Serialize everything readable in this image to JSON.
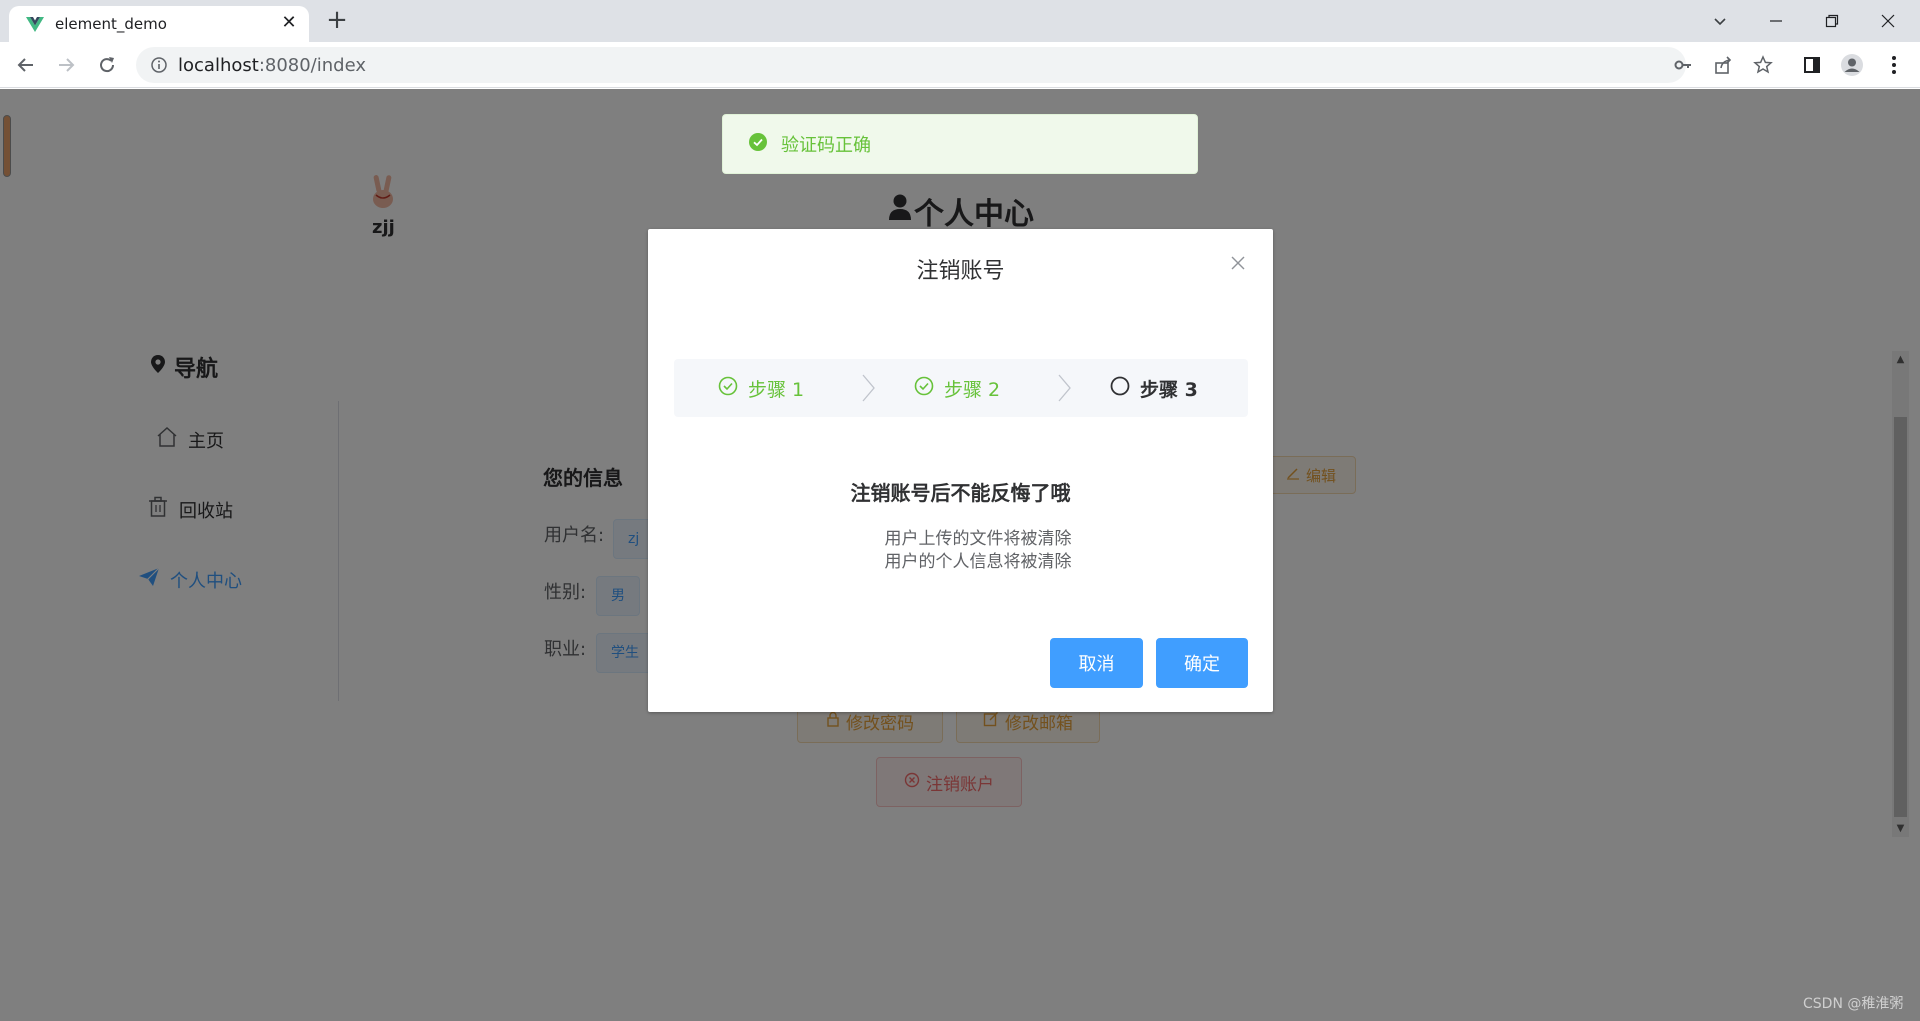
{
  "browser": {
    "tab_title": "element_demo",
    "url_host": "localhost",
    "url_path": ":8080/index"
  },
  "toast": {
    "message": "验证码正确",
    "type": "success"
  },
  "profile": {
    "username": "zjj",
    "page_title": "个人中心"
  },
  "nav": {
    "heading": "导航",
    "items": [
      {
        "label": "主页",
        "icon": "home-icon",
        "active": false
      },
      {
        "label": "回收站",
        "icon": "trash-icon",
        "active": false
      },
      {
        "label": "个人中心",
        "icon": "send-icon",
        "active": true
      }
    ]
  },
  "info": {
    "title": "您的信息",
    "edit_label": "编辑",
    "fields": [
      {
        "label": "用户名:",
        "value": "zj"
      },
      {
        "label": "性别:",
        "value": "男"
      },
      {
        "label": "职业:",
        "value": "学生"
      }
    ],
    "change_password_label": "修改密码",
    "change_email_label": "修改邮箱",
    "delete_account_label": "注销账户"
  },
  "dialog": {
    "title": "注销账号",
    "steps": [
      {
        "label": "步骤 1",
        "status": "done"
      },
      {
        "label": "步骤 2",
        "status": "done"
      },
      {
        "label": "步骤 3",
        "status": "process"
      }
    ],
    "heading": "注销账号后不能反悔了哦",
    "lines": [
      "用户上传的文件将被清除",
      "用户的个人信息将被清除"
    ],
    "cancel_label": "取消",
    "confirm_label": "确定"
  },
  "watermark": "CSDN @稚淮粥",
  "colors": {
    "primary": "#409eff",
    "success": "#67c23a",
    "warning": "#e6a23c",
    "danger": "#f56c6c"
  }
}
